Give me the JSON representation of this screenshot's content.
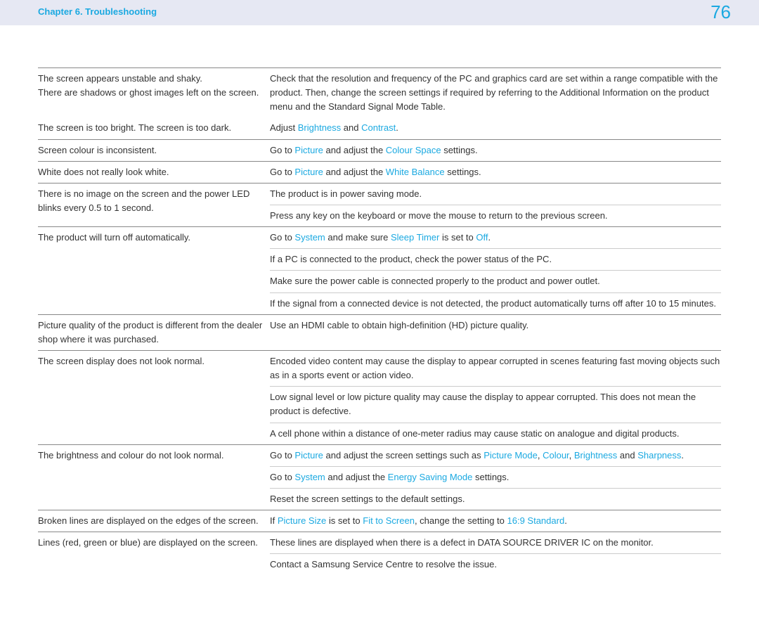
{
  "header": {
    "chapter": "Chapter 6. Troubleshooting",
    "page": "76"
  },
  "rows": {
    "r1": {
      "issue1": "The screen appears unstable and shaky.",
      "issue2": "There are shadows or ghost images left on the screen.",
      "sol": "Check that the resolution and frequency of the PC and graphics card are set within a range compatible with the product. Then, change the screen settings if required by referring to the Additional Information on the product menu and the Standard Signal Mode Table."
    },
    "r2": {
      "issue": "The screen is too bright. The screen is too dark.",
      "s_pre": "Adjust ",
      "s_l1": "Brightness",
      "s_mid": " and ",
      "s_l2": "Contrast",
      "s_post": "."
    },
    "r3": {
      "issue": "Screen colour is inconsistent.",
      "s_pre": "Go to ",
      "s_l1": "Picture",
      "s_mid": " and adjust the ",
      "s_l2": "Colour Space",
      "s_post": " settings."
    },
    "r4": {
      "issue": "White does not really look white.",
      "s_pre": "Go to ",
      "s_l1": "Picture",
      "s_mid": " and adjust the ",
      "s_l2": "White Balance",
      "s_post": " settings."
    },
    "r5": {
      "issue": "There is no image on the screen and the power LED blinks every 0.5 to 1 second.",
      "s1": "The product is in power saving mode.",
      "s2": "Press any key on the keyboard or move the mouse to return to the previous screen."
    },
    "r6": {
      "issue": "The product will turn off automatically.",
      "s1_pre": "Go to ",
      "s1_l1": "System",
      "s1_mid": " and make sure ",
      "s1_l2": "Sleep Timer",
      "s1_mid2": " is set to ",
      "s1_l3": "Off",
      "s1_post": ".",
      "s2": "If a PC is connected to the product, check the power status of the PC.",
      "s3": "Make sure the power cable is connected properly to the product and power outlet.",
      "s4": "If the signal from a connected device is not detected, the product automatically turns off after 10 to 15 minutes."
    },
    "r7": {
      "issue": "Picture quality of the product is different from the dealer shop where it was purchased.",
      "sol": "Use an HDMI cable to obtain high-definition (HD) picture quality."
    },
    "r8": {
      "issue": "The screen display does not look normal.",
      "s1": "Encoded video content may cause the display to appear corrupted in scenes featuring fast moving objects such as in a sports event or action video.",
      "s2": "Low signal level or low picture quality may cause the display to appear corrupted. This does not mean the product is defective.",
      "s3": "A cell phone within a distance of one-meter radius may cause static on analogue and digital products."
    },
    "r9": {
      "issue": "The brightness and colour do not look normal.",
      "s1_pre": "Go to ",
      "s1_l1": "Picture",
      "s1_mid": " and adjust the screen settings such as ",
      "s1_l2": "Picture Mode",
      "s1_c1": ", ",
      "s1_l3": "Colour",
      "s1_c2": ", ",
      "s1_l4": "Brightness",
      "s1_c3": " and ",
      "s1_l5": "Sharpness",
      "s1_post": ".",
      "s2_pre": "Go to ",
      "s2_l1": "System",
      "s2_mid": " and adjust the ",
      "s2_l2": "Energy Saving Mode",
      "s2_post": " settings.",
      "s3": "Reset the screen settings to the default settings."
    },
    "r10": {
      "issue": "Broken lines are displayed on the edges of the screen.",
      "s_pre": "If ",
      "s_l1": "Picture Size",
      "s_mid": " is set to ",
      "s_l2": "Fit to Screen",
      "s_mid2": ", change the setting to ",
      "s_l3": "16:9 Standard",
      "s_post": "."
    },
    "r11": {
      "issue": "Lines (red, green or blue) are displayed on the screen.",
      "s1": "These lines are displayed when there is a defect in DATA SOURCE DRIVER IC on the monitor.",
      "s2": "Contact a Samsung Service Centre to resolve the issue."
    }
  }
}
